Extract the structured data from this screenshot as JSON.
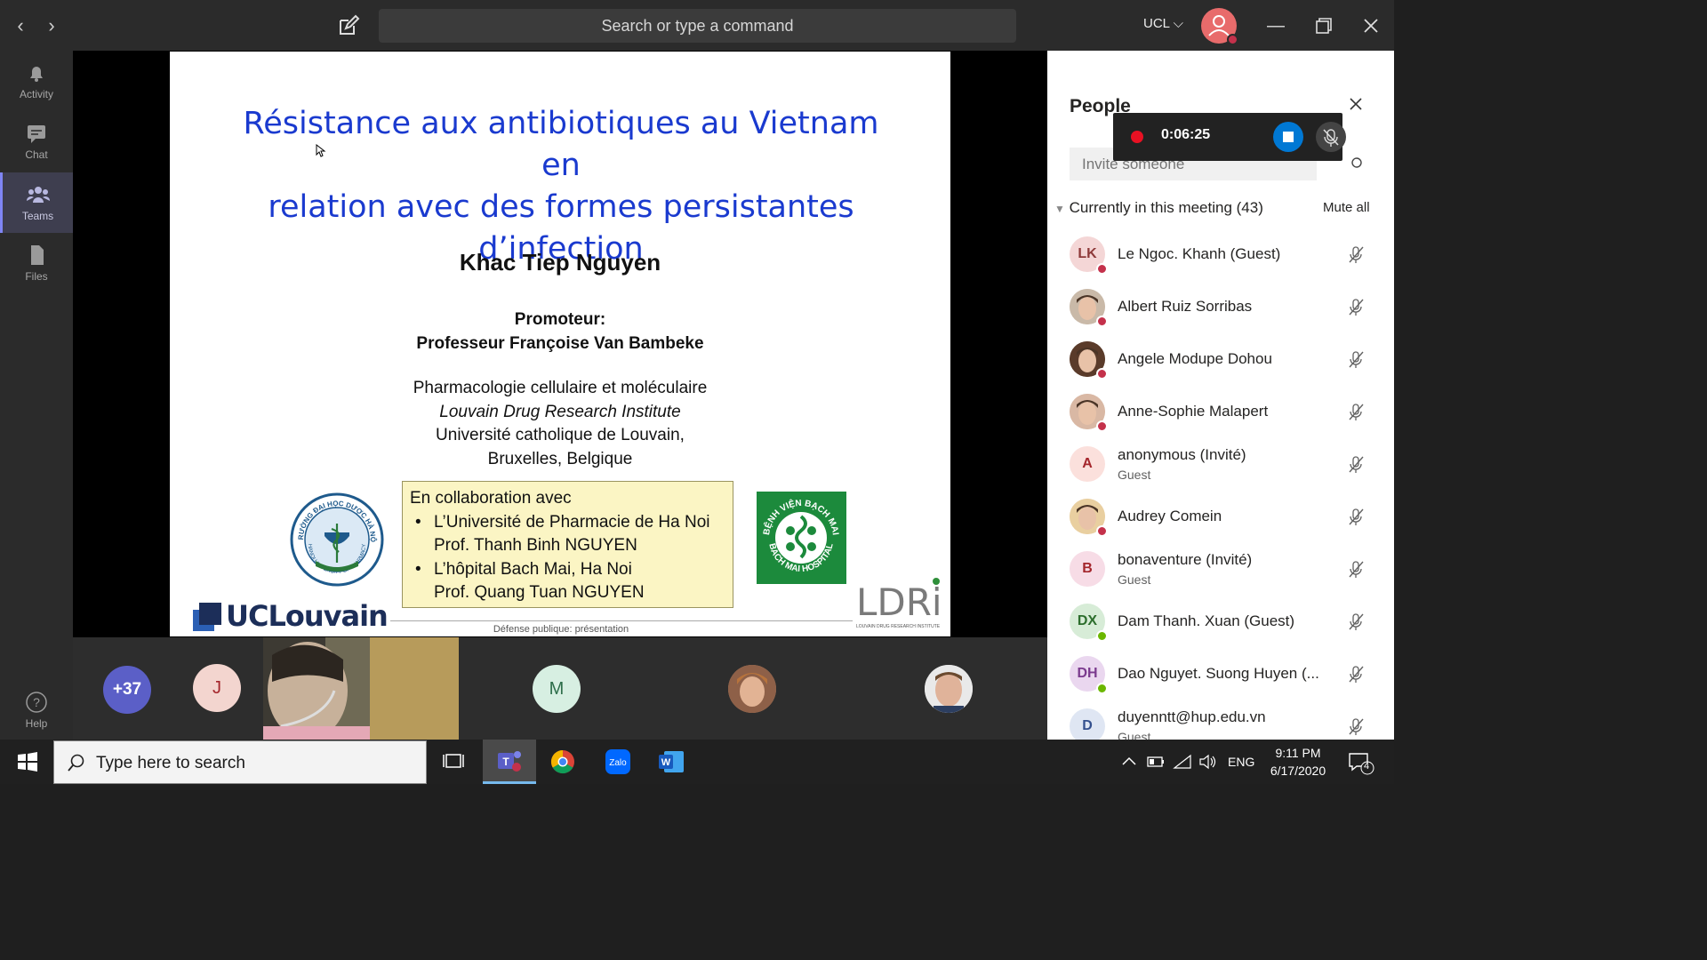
{
  "titlebar": {
    "search_placeholder": "Search or type a command",
    "org": "UCL ⌵"
  },
  "rail": [
    {
      "label": "Activity",
      "icon": "bell-icon",
      "active": false
    },
    {
      "label": "Chat",
      "icon": "chat-icon",
      "active": false
    },
    {
      "label": "Teams",
      "icon": "teams-icon",
      "active": true
    },
    {
      "label": "Files",
      "icon": "file-icon",
      "active": false
    }
  ],
  "rail_help": "Help",
  "slide": {
    "title_lines": [
      "Résistance aux antibiotiques au Vietnam en",
      "relation avec des formes persistantes",
      "d’infection"
    ],
    "author": "Khac Tiep Nguyen",
    "promoteur_label": "Promoteur:",
    "promoteur_name": "Professeur Françoise Van Bambeke",
    "affiliation": [
      "Pharmacologie cellulaire et moléculaire",
      "Louvain Drug Research Institute",
      "Université catholique de Louvain,",
      "Bruxelles, Belgique"
    ],
    "collab_heading": "En collaboration avec",
    "collab_items": [
      "L’Université de Pharmacie de Ha Noi",
      "Prof. Thanh Binh NGUYEN",
      "L’hôpital Bach Mai, Ha Noi",
      "Prof. Quang Tuan NGUYEN"
    ],
    "uclouvain": "UCLouvain",
    "footer": "Défense publique: présentation",
    "ldri": "LDRi",
    "ldri_sub": "LOUVAIN DRUG RESEARCH INSTITUTE",
    "seal_text": "TRƯỜNG ĐẠI HỌC DƯỢC HÀ NỘI",
    "seal_text_bottom": "HANOI UNIVERSITY OF PHARMACY",
    "hospital_text": "BỆNH VIỆN BẠCH MAI",
    "hospital_text_bottom": "BACH MAI HOSPITAL"
  },
  "strip": {
    "overflow": "+37",
    "tiles": [
      "J",
      "M"
    ]
  },
  "panel": {
    "title": "People",
    "recording_time": "0:06:25",
    "invite_placeholder": "Invite someone",
    "section": "Currently in this meeting (43)",
    "mute_all": "Mute all",
    "colors": {
      "red": "#c4314b",
      "green": "#6bb700"
    },
    "participants": [
      {
        "initials": "LK",
        "name": "Le Ngoc. Khanh (Guest)",
        "sub": "",
        "bg": "#f4d6d6",
        "fg": "#8e3a3a",
        "status": "#c4314b",
        "photo": false
      },
      {
        "initials": "",
        "name": "Albert Ruiz Sorribas",
        "sub": "",
        "bg": "#c9b9a8",
        "fg": "#333",
        "status": "#c4314b",
        "photo": true
      },
      {
        "initials": "",
        "name": "Angele Modupe Dohou",
        "sub": "",
        "bg": "#5a3b2a",
        "fg": "#fff",
        "status": "#c4314b",
        "photo": true
      },
      {
        "initials": "",
        "name": "Anne-Sophie Malapert",
        "sub": "",
        "bg": "#d9b8a4",
        "fg": "#333",
        "status": "#c4314b",
        "photo": true
      },
      {
        "initials": "A",
        "name": "anonymous (Invité)",
        "sub": "Guest",
        "bg": "#fbe0dc",
        "fg": "#a4262c",
        "status": "",
        "photo": false
      },
      {
        "initials": "",
        "name": "Audrey Comein",
        "sub": "",
        "bg": "#e9cfa0",
        "fg": "#333",
        "status": "#c4314b",
        "photo": true
      },
      {
        "initials": "B",
        "name": "bonaventure (Invité)",
        "sub": "Guest",
        "bg": "#f7dce6",
        "fg": "#a4262c",
        "status": "",
        "photo": false
      },
      {
        "initials": "DX",
        "name": "Dam Thanh. Xuan (Guest)",
        "sub": "",
        "bg": "#d7ecd7",
        "fg": "#2d6e2d",
        "status": "#6bb700",
        "photo": false
      },
      {
        "initials": "DH",
        "name": "Dao Nguyet. Suong Huyen (...",
        "sub": "",
        "bg": "#ead7ef",
        "fg": "#7b3b8e",
        "status": "#6bb700",
        "photo": false
      },
      {
        "initials": "D",
        "name": "duyenntt@hup.edu.vn",
        "sub": "Guest",
        "bg": "#dfe6f3",
        "fg": "#34508e",
        "status": "",
        "photo": false
      }
    ]
  },
  "taskbar": {
    "search_placeholder": "Type here to search",
    "lang": "ENG",
    "time": "9:11 PM",
    "date": "6/17/2020",
    "notif_count": "4",
    "zalo": "Zalo"
  }
}
